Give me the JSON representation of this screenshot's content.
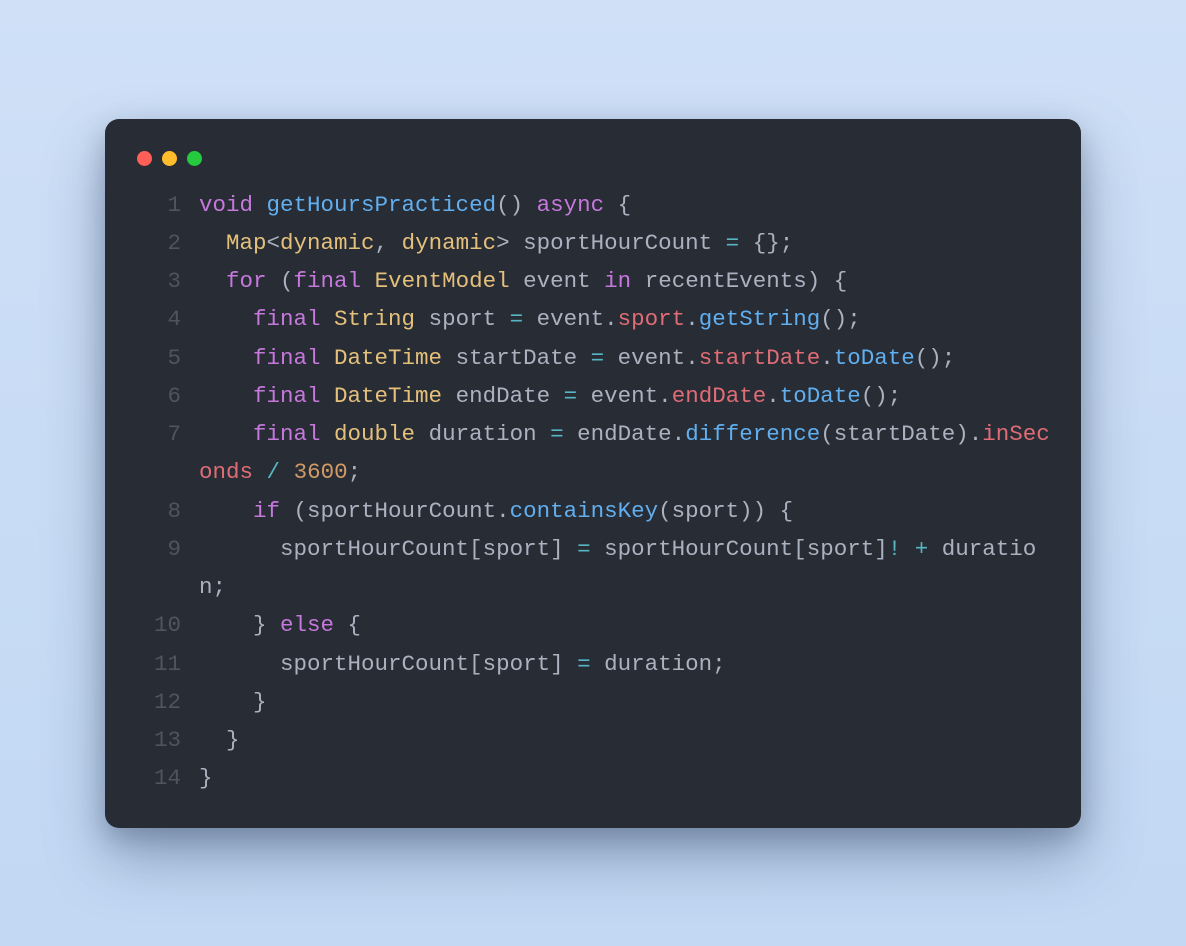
{
  "window": {
    "buttons": [
      "close",
      "minimize",
      "zoom"
    ]
  },
  "code": {
    "language": "dart",
    "lines": [
      {
        "n": "1",
        "tokens": [
          {
            "t": "void",
            "c": "kw"
          },
          {
            "t": " ",
            "c": "pn"
          },
          {
            "t": "getHoursPracticed",
            "c": "fn"
          },
          {
            "t": "()",
            "c": "pn"
          },
          {
            "t": " ",
            "c": "pn"
          },
          {
            "t": "async",
            "c": "kw"
          },
          {
            "t": " ",
            "c": "pn"
          },
          {
            "t": "{",
            "c": "pn"
          }
        ]
      },
      {
        "n": "2",
        "tokens": [
          {
            "t": "  ",
            "c": "pn"
          },
          {
            "t": "Map",
            "c": "ty"
          },
          {
            "t": "<",
            "c": "pn"
          },
          {
            "t": "dynamic",
            "c": "tygen"
          },
          {
            "t": ", ",
            "c": "pn"
          },
          {
            "t": "dynamic",
            "c": "tygen"
          },
          {
            "t": ">",
            "c": "pn"
          },
          {
            "t": " ",
            "c": "pn"
          },
          {
            "t": "sportHourCount",
            "c": "id"
          },
          {
            "t": " ",
            "c": "pn"
          },
          {
            "t": "=",
            "c": "op"
          },
          {
            "t": " ",
            "c": "pn"
          },
          {
            "t": "{};",
            "c": "pn"
          }
        ]
      },
      {
        "n": "3",
        "tokens": [
          {
            "t": "  ",
            "c": "pn"
          },
          {
            "t": "for",
            "c": "kw"
          },
          {
            "t": " (",
            "c": "pn"
          },
          {
            "t": "final",
            "c": "kw"
          },
          {
            "t": " ",
            "c": "pn"
          },
          {
            "t": "EventModel",
            "c": "ty"
          },
          {
            "t": " ",
            "c": "pn"
          },
          {
            "t": "event",
            "c": "id"
          },
          {
            "t": " ",
            "c": "pn"
          },
          {
            "t": "in",
            "c": "kw2"
          },
          {
            "t": " ",
            "c": "pn"
          },
          {
            "t": "recentEvents",
            "c": "id"
          },
          {
            "t": ") {",
            "c": "pn"
          }
        ]
      },
      {
        "n": "4",
        "tokens": [
          {
            "t": "    ",
            "c": "pn"
          },
          {
            "t": "final",
            "c": "kw"
          },
          {
            "t": " ",
            "c": "pn"
          },
          {
            "t": "String",
            "c": "ty"
          },
          {
            "t": " ",
            "c": "pn"
          },
          {
            "t": "sport",
            "c": "id"
          },
          {
            "t": " ",
            "c": "pn"
          },
          {
            "t": "=",
            "c": "op"
          },
          {
            "t": " ",
            "c": "pn"
          },
          {
            "t": "event",
            "c": "id"
          },
          {
            "t": ".",
            "c": "pn"
          },
          {
            "t": "sport",
            "c": "prop"
          },
          {
            "t": ".",
            "c": "pn"
          },
          {
            "t": "getString",
            "c": "fn"
          },
          {
            "t": "();",
            "c": "pn"
          }
        ]
      },
      {
        "n": "5",
        "tokens": [
          {
            "t": "    ",
            "c": "pn"
          },
          {
            "t": "final",
            "c": "kw"
          },
          {
            "t": " ",
            "c": "pn"
          },
          {
            "t": "DateTime",
            "c": "ty"
          },
          {
            "t": " ",
            "c": "pn"
          },
          {
            "t": "startDate",
            "c": "id"
          },
          {
            "t": " ",
            "c": "pn"
          },
          {
            "t": "=",
            "c": "op"
          },
          {
            "t": " ",
            "c": "pn"
          },
          {
            "t": "event",
            "c": "id"
          },
          {
            "t": ".",
            "c": "pn"
          },
          {
            "t": "startDate",
            "c": "prop"
          },
          {
            "t": ".",
            "c": "pn"
          },
          {
            "t": "toDate",
            "c": "fn"
          },
          {
            "t": "();",
            "c": "pn"
          }
        ]
      },
      {
        "n": "6",
        "tokens": [
          {
            "t": "    ",
            "c": "pn"
          },
          {
            "t": "final",
            "c": "kw"
          },
          {
            "t": " ",
            "c": "pn"
          },
          {
            "t": "DateTime",
            "c": "ty"
          },
          {
            "t": " ",
            "c": "pn"
          },
          {
            "t": "endDate",
            "c": "id"
          },
          {
            "t": " ",
            "c": "pn"
          },
          {
            "t": "=",
            "c": "op"
          },
          {
            "t": " ",
            "c": "pn"
          },
          {
            "t": "event",
            "c": "id"
          },
          {
            "t": ".",
            "c": "pn"
          },
          {
            "t": "endDate",
            "c": "prop"
          },
          {
            "t": ".",
            "c": "pn"
          },
          {
            "t": "toDate",
            "c": "fn"
          },
          {
            "t": "();",
            "c": "pn"
          }
        ]
      },
      {
        "n": "7",
        "tokens": [
          {
            "t": "    ",
            "c": "pn"
          },
          {
            "t": "final",
            "c": "kw"
          },
          {
            "t": " ",
            "c": "pn"
          },
          {
            "t": "double",
            "c": "ty"
          },
          {
            "t": " ",
            "c": "pn"
          },
          {
            "t": "duration",
            "c": "id"
          },
          {
            "t": " ",
            "c": "pn"
          },
          {
            "t": "=",
            "c": "op"
          },
          {
            "t": " ",
            "c": "pn"
          },
          {
            "t": "endDate",
            "c": "id"
          },
          {
            "t": ".",
            "c": "pn"
          },
          {
            "t": "difference",
            "c": "fn"
          },
          {
            "t": "(",
            "c": "pn"
          },
          {
            "t": "startDate",
            "c": "id"
          },
          {
            "t": ").",
            "c": "pn"
          },
          {
            "t": "inSeconds",
            "c": "prop"
          },
          {
            "t": " ",
            "c": "pn"
          },
          {
            "t": "/",
            "c": "op"
          },
          {
            "t": " ",
            "c": "pn"
          },
          {
            "t": "3600",
            "c": "num"
          },
          {
            "t": ";",
            "c": "pn"
          }
        ]
      },
      {
        "n": "8",
        "tokens": [
          {
            "t": "    ",
            "c": "pn"
          },
          {
            "t": "if",
            "c": "kw"
          },
          {
            "t": " (",
            "c": "pn"
          },
          {
            "t": "sportHourCount",
            "c": "id"
          },
          {
            "t": ".",
            "c": "pn"
          },
          {
            "t": "containsKey",
            "c": "fn"
          },
          {
            "t": "(",
            "c": "pn"
          },
          {
            "t": "sport",
            "c": "id"
          },
          {
            "t": ")) {",
            "c": "pn"
          }
        ]
      },
      {
        "n": "9",
        "tokens": [
          {
            "t": "      ",
            "c": "pn"
          },
          {
            "t": "sportHourCount",
            "c": "id"
          },
          {
            "t": "[",
            "c": "pn"
          },
          {
            "t": "sport",
            "c": "id"
          },
          {
            "t": "]",
            "c": "pn"
          },
          {
            "t": " ",
            "c": "pn"
          },
          {
            "t": "=",
            "c": "op"
          },
          {
            "t": " ",
            "c": "pn"
          },
          {
            "t": "sportHourCount",
            "c": "id"
          },
          {
            "t": "[",
            "c": "pn"
          },
          {
            "t": "sport",
            "c": "id"
          },
          {
            "t": "]",
            "c": "pn"
          },
          {
            "t": "!",
            "c": "op"
          },
          {
            "t": " ",
            "c": "pn"
          },
          {
            "t": "+",
            "c": "op"
          },
          {
            "t": " ",
            "c": "pn"
          },
          {
            "t": "duration",
            "c": "id"
          },
          {
            "t": ";",
            "c": "pn"
          }
        ]
      },
      {
        "n": "10",
        "tokens": [
          {
            "t": "    } ",
            "c": "pn"
          },
          {
            "t": "else",
            "c": "kw"
          },
          {
            "t": " {",
            "c": "pn"
          }
        ]
      },
      {
        "n": "11",
        "tokens": [
          {
            "t": "      ",
            "c": "pn"
          },
          {
            "t": "sportHourCount",
            "c": "id"
          },
          {
            "t": "[",
            "c": "pn"
          },
          {
            "t": "sport",
            "c": "id"
          },
          {
            "t": "]",
            "c": "pn"
          },
          {
            "t": " ",
            "c": "pn"
          },
          {
            "t": "=",
            "c": "op"
          },
          {
            "t": " ",
            "c": "pn"
          },
          {
            "t": "duration",
            "c": "id"
          },
          {
            "t": ";",
            "c": "pn"
          }
        ]
      },
      {
        "n": "12",
        "tokens": [
          {
            "t": "    }",
            "c": "pn"
          }
        ]
      },
      {
        "n": "13",
        "tokens": [
          {
            "t": "  }",
            "c": "pn"
          }
        ]
      },
      {
        "n": "14",
        "tokens": [
          {
            "t": "}",
            "c": "pn"
          }
        ]
      }
    ]
  }
}
